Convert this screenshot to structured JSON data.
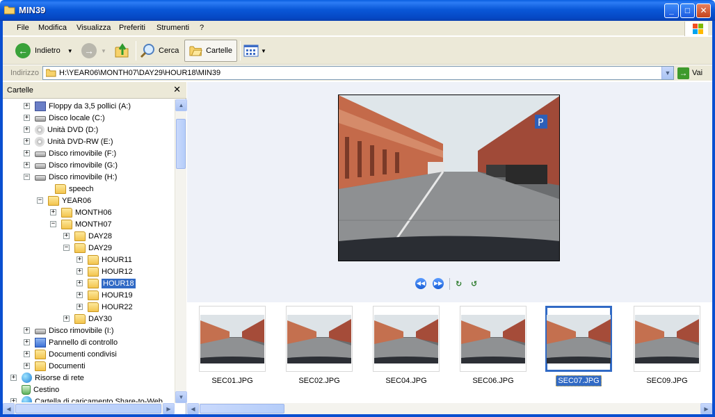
{
  "window": {
    "title": "MIN39"
  },
  "menu": [
    "File",
    "Modifica",
    "Visualizza",
    "Preferiti",
    "Strumenti",
    "?"
  ],
  "toolbar": {
    "back_label": "Indietro",
    "search_label": "Cerca",
    "folders_label": "Cartelle"
  },
  "address": {
    "label": "Indirizzo",
    "path": "H:\\YEAR06\\MONTH07\\DAY29\\HOUR18\\MIN39",
    "go_label": "Vai"
  },
  "folder_pane": {
    "title": "Cartelle",
    "items": [
      {
        "label": "Floppy da 3,5 pollici (A:)",
        "icon": "floppy-icon",
        "expander": "+"
      },
      {
        "label": "Disco locale (C:)",
        "icon": "drive-icon",
        "expander": "+"
      },
      {
        "label": "Unità DVD (D:)",
        "icon": "dvd-drive-icon",
        "expander": "+"
      },
      {
        "label": "Unità DVD-RW (E:)",
        "icon": "dvd-drive-icon",
        "expander": "+"
      },
      {
        "label": "Disco rimovibile (F:)",
        "icon": "removable-drive-icon",
        "expander": "+"
      },
      {
        "label": "Disco rimovibile (G:)",
        "icon": "removable-drive-icon",
        "expander": "+"
      },
      {
        "label": "Disco rimovibile (H:)",
        "icon": "removable-drive-icon",
        "expander": "−"
      },
      {
        "label": "speech",
        "icon": "folder-icon",
        "expander": ""
      },
      {
        "label": "YEAR06",
        "icon": "folder-icon",
        "expander": "−"
      },
      {
        "label": "MONTH06",
        "icon": "folder-icon",
        "expander": "+"
      },
      {
        "label": "MONTH07",
        "icon": "folder-icon",
        "expander": "−"
      },
      {
        "label": "DAY28",
        "icon": "folder-icon",
        "expander": "+"
      },
      {
        "label": "DAY29",
        "icon": "folder-icon",
        "expander": "−"
      },
      {
        "label": "HOUR11",
        "icon": "folder-icon",
        "expander": "+"
      },
      {
        "label": "HOUR12",
        "icon": "folder-icon",
        "expander": "+"
      },
      {
        "label": "HOUR18",
        "icon": "folder-icon",
        "expander": "+",
        "selected": true
      },
      {
        "label": "HOUR19",
        "icon": "folder-icon",
        "expander": "+"
      },
      {
        "label": "HOUR22",
        "icon": "folder-icon",
        "expander": "+"
      },
      {
        "label": "DAY30",
        "icon": "folder-icon",
        "expander": "+"
      },
      {
        "label": "Disco rimovibile (I:)",
        "icon": "removable-drive-icon",
        "expander": "+"
      },
      {
        "label": "Pannello di controllo",
        "icon": "control-panel-icon",
        "expander": "+"
      },
      {
        "label": "Documenti condivisi",
        "icon": "folder-icon",
        "expander": "+"
      },
      {
        "label": "Documenti",
        "icon": "folder-icon",
        "expander": "+"
      },
      {
        "label": "Risorse di rete",
        "icon": "network-icon",
        "expander": "+"
      },
      {
        "label": "Cestino",
        "icon": "recycle-bin-icon",
        "expander": ""
      },
      {
        "label": "Cartella di caricamento Share-to-Web",
        "icon": "globe-icon",
        "expander": "+"
      }
    ]
  },
  "thumbnails": [
    {
      "label": "SEC01.JPG"
    },
    {
      "label": "SEC02.JPG"
    },
    {
      "label": "SEC04.JPG"
    },
    {
      "label": "SEC06.JPG"
    },
    {
      "label": "SEC07.JPG",
      "selected": true
    },
    {
      "label": "SEC09.JPG"
    }
  ],
  "colors": {
    "titlebar": "#0548c4",
    "selection": "#316ac5",
    "chrome": "#ece9d8"
  }
}
